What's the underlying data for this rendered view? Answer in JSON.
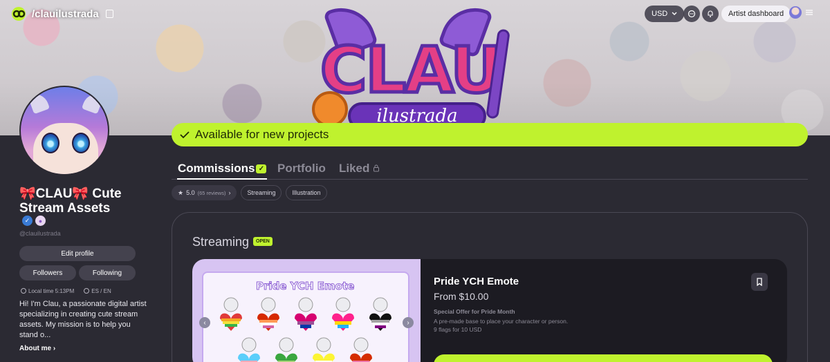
{
  "topbar": {
    "handle": "/clauilustrada",
    "currency": "USD",
    "dashboard_label": "Artist dashboard"
  },
  "banner": {
    "logo_text": "CLAU",
    "logo_subtext": "ilustrada"
  },
  "availability": {
    "text": "Available for new projects",
    "color": "#bff22e"
  },
  "profile": {
    "name": "🎀CLAU🎀 Cute Stream Assets",
    "handle": "@clauilustrada",
    "edit_label": "Edit profile",
    "followers_label": "Followers",
    "following_label": "Following",
    "local_time": "Local time 5:13PM",
    "languages": "ES / EN",
    "bio": "Hi! I'm Clau, a passionate digital artist specializing in creating cute stream assets. My mission is to help you stand o...",
    "about_label": "About me"
  },
  "tabs": [
    {
      "label": "Commissions",
      "active": true
    },
    {
      "label": "Portfolio",
      "active": false
    },
    {
      "label": "Liked",
      "active": false
    }
  ],
  "chips": {
    "rating": "5.0",
    "reviews": "(65 reviews)",
    "tags": [
      "Streaming",
      "Illustration"
    ]
  },
  "section": {
    "title": "Streaming",
    "status": "OPEN"
  },
  "item": {
    "thumb_title": "Pride YCH Emote",
    "title": "Pride YCH Emote",
    "price": "From $10.00",
    "subtitle": "Special Offer for Pride Month",
    "desc_line1": "A pre-made base to place your character or person.",
    "desc_line2": "9 flags for 10 USD"
  },
  "icons": {
    "brand": "ko-fi-style-logo-icon",
    "copy": "copy-icon",
    "chat": "chat-bubble-icon",
    "bell": "bell-icon",
    "menu": "hamburger-icon",
    "bookmark": "bookmark-icon",
    "star": "star-icon",
    "lock": "lock-icon",
    "check": "check-icon"
  }
}
